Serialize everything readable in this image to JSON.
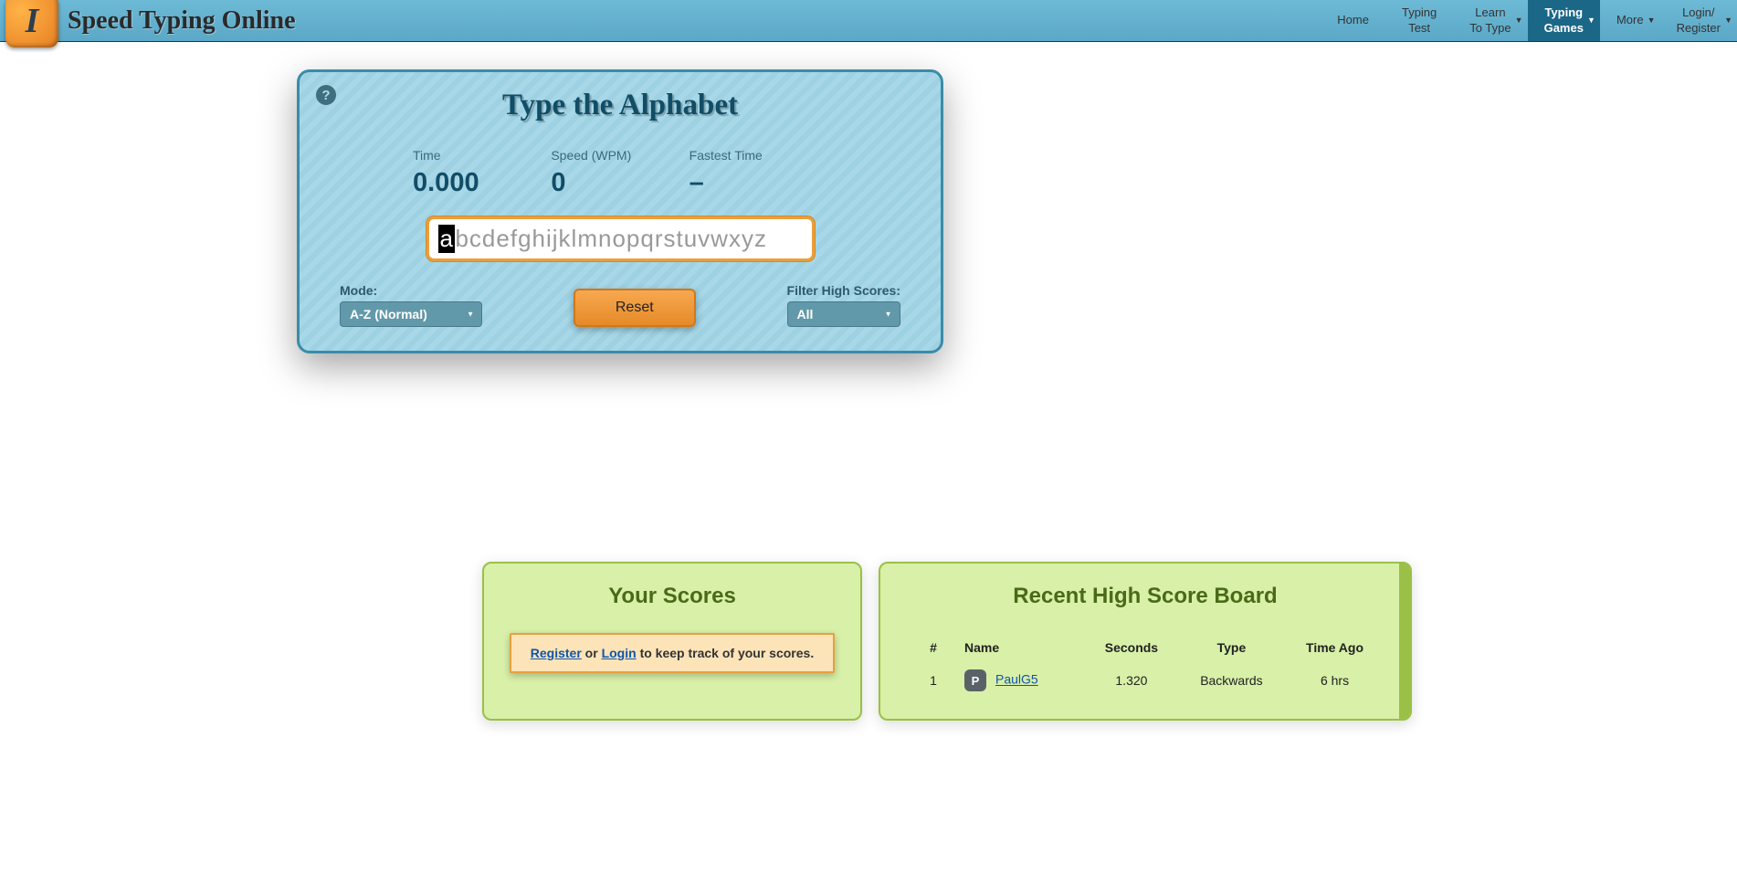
{
  "header": {
    "site_title": "Speed Typing Online",
    "nav": [
      {
        "label": "Home",
        "sub": "",
        "dropdown": false,
        "active": false
      },
      {
        "label": "Typing",
        "sub": "Test",
        "dropdown": false,
        "active": false
      },
      {
        "label": "Learn",
        "sub": "To Type",
        "dropdown": true,
        "active": false
      },
      {
        "label": "Typing",
        "sub": "Games",
        "dropdown": true,
        "active": true
      },
      {
        "label": "More",
        "sub": "",
        "dropdown": true,
        "active": false
      },
      {
        "label": "Login/",
        "sub": "Register",
        "dropdown": true,
        "active": false
      }
    ]
  },
  "game": {
    "title": "Type the Alphabet",
    "stats": {
      "time_label": "Time",
      "time_value": "0.000",
      "speed_label": "Speed (WPM)",
      "speed_value": "0",
      "fastest_label": "Fastest Time",
      "fastest_value": "–"
    },
    "current_letter": "a",
    "rest_letters": "bcdefghijklmnopqrstuvwxyz",
    "mode_label": "Mode:",
    "mode_selected": "A-Z (Normal)",
    "reset_label": "Reset",
    "filter_label": "Filter High Scores:",
    "filter_selected": "All"
  },
  "your_scores": {
    "title": "Your Scores",
    "message_before": "",
    "register_text": "Register",
    "or_text": " or ",
    "login_text": "Login",
    "message_after": " to keep track of your scores."
  },
  "highscores": {
    "title": "Recent High Score Board",
    "columns": {
      "rank": "#",
      "name": "Name",
      "seconds": "Seconds",
      "type": "Type",
      "time_ago": "Time Ago"
    },
    "rows": [
      {
        "rank": "1",
        "avatar_letter": "P",
        "name": "PaulG5",
        "seconds": "1.320",
        "type": "Backwards",
        "time_ago": "6 hrs"
      }
    ]
  }
}
